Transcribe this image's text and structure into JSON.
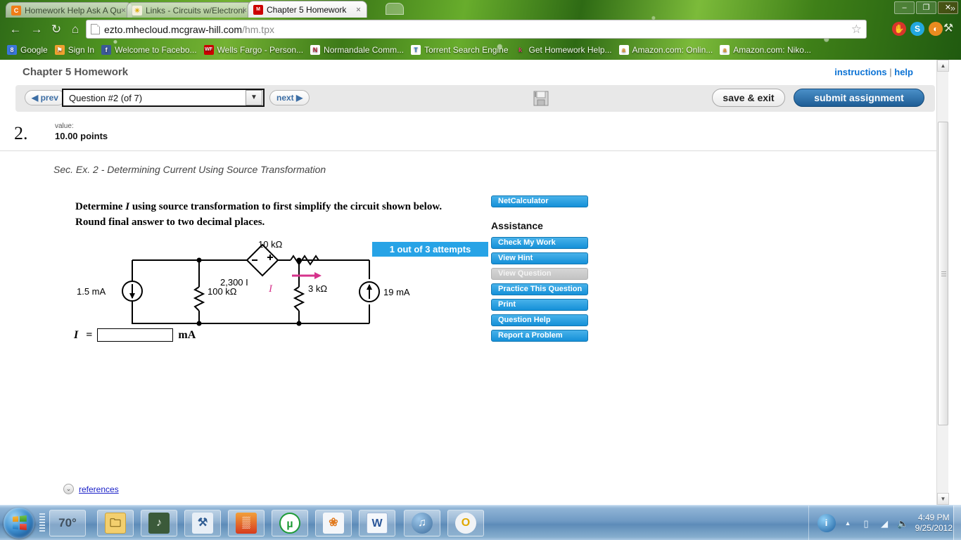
{
  "browser": {
    "tabs": [
      {
        "title": "Homework Help Ask A Qu",
        "favicon_text": "C",
        "favicon_color": "#ef7d17",
        "active": false
      },
      {
        "title": "Links - Circuits w/Electroni",
        "favicon_text": "✳",
        "favicon_color": "#f3efdc",
        "active": false
      },
      {
        "title": "Chapter 5 Homework",
        "favicon_text": "M",
        "favicon_color": "#cc0000",
        "active": true
      }
    ],
    "tab_close_label": "×",
    "new_tab_label": "new-tab",
    "nav": {
      "back_icon": "←",
      "forward_icon": "→",
      "reload_icon": "↻",
      "home_icon": "⌂"
    },
    "url": {
      "domain": "ezto.mhecloud.mcgraw-hill.com",
      "path": "/hm.tpx"
    },
    "star_icon": "☆",
    "extensions": [
      {
        "name": "adblock-icon",
        "glyph": "✋",
        "color": "#d9342b"
      },
      {
        "name": "skype-icon",
        "glyph": "S",
        "color": "#23a8e0"
      },
      {
        "name": "orbit-icon",
        "glyph": "◐",
        "color": "#e98b20"
      }
    ],
    "wrench_icon": "⚒",
    "bookmarks": [
      {
        "label": "Google",
        "ico": "8",
        "color": "#3b77dc"
      },
      {
        "label": "Sign In",
        "ico": "⚑",
        "color": "#f0a030"
      },
      {
        "label": "Welcome to Facebo...",
        "ico": "f",
        "color": "#3b5998"
      },
      {
        "label": "Wells Fargo - Person...",
        "ico": "WF",
        "color": "#cc0000"
      },
      {
        "label": "Normandale Comm...",
        "ico": "N",
        "color": "#b01c2e"
      },
      {
        "label": "Torrent Search Engine",
        "ico": "T",
        "color": "#1d6fbf"
      },
      {
        "label": "Get Homework Help...",
        "ico": "ƙ",
        "color": "#e0356f"
      },
      {
        "label": "Amazon.com: Onlin...",
        "ico": "a",
        "color": "#f0a43a"
      },
      {
        "label": "Amazon.com: Niko...",
        "ico": "a",
        "color": "#f0a43a"
      }
    ],
    "bookmarks_overflow": "»",
    "window_buttons": {
      "minimize": "–",
      "maximize": "❐",
      "close": "✕"
    }
  },
  "page": {
    "course_title": "Chapter 5 Homework",
    "header_links": {
      "instructions": "instructions",
      "separator": " | ",
      "help": "help"
    },
    "toolbar": {
      "prev_label": "◀ prev",
      "next_label": "next ▶",
      "question_selector_value": "Question #2 (of 7)",
      "question_selector_arrow": "▼",
      "save_icon_name": "floppy-disk-save-icon",
      "save_exit_label": "save & exit",
      "submit_label": "submit assignment"
    },
    "question": {
      "number": "2.",
      "value_label": "value:",
      "points": "10.00 points",
      "section_title": "Sec. Ex. 2 - Determining Current Using Source Transformation",
      "attempts_badge": "1 out of 3 attempts",
      "prompt_part1": "Determine ",
      "prompt_italic": "I",
      "prompt_part2": " using source transformation to first simplify the circuit shown below. Round final answer to two decimal places.",
      "answer_prefix": "I =",
      "answer_value": "",
      "answer_placeholder": "",
      "answer_unit": "mA"
    },
    "references": {
      "chevron": "⌄",
      "label": "references"
    },
    "assistance": {
      "netcalculator_label": "NetCalculator",
      "heading": "Assistance",
      "buttons": [
        {
          "label": "Check My Work",
          "disabled": false
        },
        {
          "label": "View Hint",
          "disabled": false
        },
        {
          "label": "View Question",
          "disabled": true
        },
        {
          "label": "Practice This Question",
          "disabled": false
        },
        {
          "label": "Print",
          "disabled": false
        },
        {
          "label": "Question Help",
          "disabled": false
        },
        {
          "label": "Report a Problem",
          "disabled": false
        }
      ]
    },
    "scrollbar": {
      "up": "▲",
      "down": "▼"
    }
  },
  "circuit": {
    "source_left_label": "1.5 mA",
    "resistor_left_label": "100 kΩ",
    "dependent_source_label": "2,300 I",
    "dependent_source_minus": "−",
    "dependent_source_plus": "+",
    "resistor_top_label": "10 kΩ",
    "current_label": "I",
    "resistor_right_label": "3 kΩ",
    "source_right_label": "19 mA",
    "current_arrow_color": "#d6338c"
  },
  "taskbar": {
    "start_name": "windows-start-orb",
    "items": [
      {
        "name": "weather-gadget",
        "glyph": "70°",
        "color": "#e8eef4",
        "text_color": "#4a5a68"
      },
      {
        "name": "windows-explorer-icon",
        "glyph": "🗀",
        "color": "#f2cf72",
        "text_color": "#7a5c10"
      },
      {
        "name": "media-player-icon",
        "glyph": "♪",
        "color": "#3b5a3a",
        "text_color": "#e8f3e6"
      },
      {
        "name": "system-tools-icon",
        "glyph": "⚒",
        "color": "#dfe7ef",
        "text_color": "#2f5c93"
      },
      {
        "name": "winrar-icon",
        "glyph": "▒",
        "color": "#e8572a",
        "text_color": "#ffffff"
      },
      {
        "name": "utorrent-icon",
        "glyph": "µ",
        "color": "#ffffff",
        "text_color": "#1e9b37"
      },
      {
        "name": "photo-viewer-icon",
        "glyph": "❀",
        "color": "#f1f3f6",
        "text_color": "#e07a20"
      },
      {
        "name": "microsoft-word-icon",
        "glyph": "W",
        "color": "#f4f7fb",
        "text_color": "#2a5699"
      },
      {
        "name": "itunes-icon",
        "glyph": "♫",
        "color": "#4a6f96",
        "text_color": "#ffffff"
      },
      {
        "name": "opera-icon",
        "glyph": "O",
        "color": "#e8b820",
        "text_color": "#ffffff"
      }
    ],
    "tray": {
      "action_center_glyph": "i",
      "overflow_arrow": "▲",
      "battery_icon": "▯",
      "network_icon": "◢",
      "volume_icon": "🔈",
      "time": "4:49 PM",
      "date": "9/25/2012"
    }
  }
}
